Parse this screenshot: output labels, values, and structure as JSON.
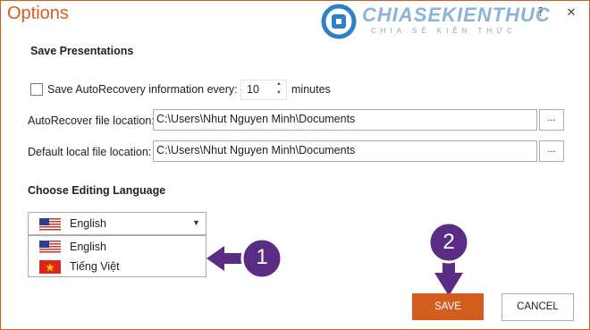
{
  "window": {
    "title": "Options",
    "help_label": "?",
    "close_label": "✕",
    "accent_color": "#d35d1f"
  },
  "watermark": {
    "brand": "CHIASEKIENTHUC",
    "tagline": "CHIA SẺ KIẾN THỨC"
  },
  "save_presentations": {
    "heading": "Save Presentations",
    "autorecovery_label": "Save AutoRecovery information every:",
    "autorecovery_checked": false,
    "autorecovery_minutes": "10",
    "minutes_label": "minutes",
    "autorecover_location_label": "AutoRecover file location:",
    "autorecover_location_value": "C:\\Users\\Nhut Nguyen Minh\\Documents",
    "default_location_label": "Default local file location:",
    "default_location_value": "C:\\Users\\Nhut Nguyen Minh\\Documents",
    "browse_label": "..."
  },
  "editing_language": {
    "heading": "Choose Editing Language",
    "selected": "English",
    "options": [
      {
        "label": "English",
        "flag": "us-flag-icon"
      },
      {
        "label": "Tiếng Việt",
        "flag": "vietnam-flag-icon"
      }
    ]
  },
  "buttons": {
    "save": "SAVE",
    "cancel": "CANCEL"
  },
  "annotations": {
    "step1": "1",
    "step2": "2",
    "color": "#5b2c83"
  }
}
